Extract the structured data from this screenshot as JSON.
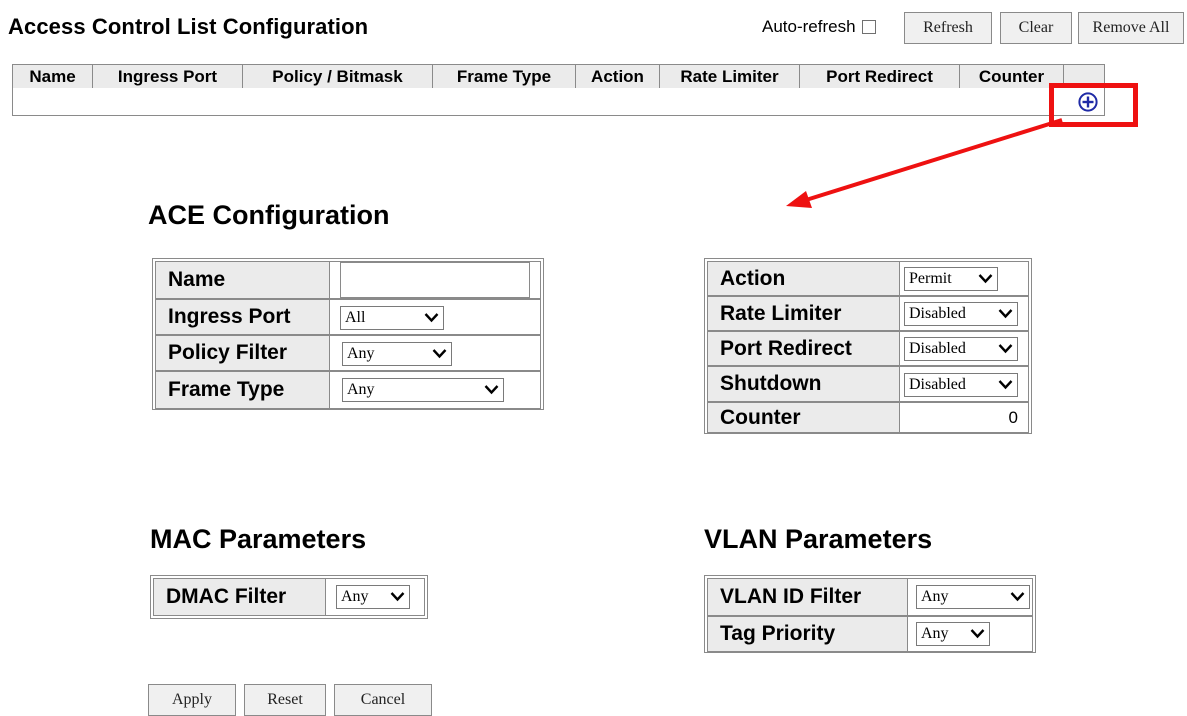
{
  "header": {
    "title": "Access Control List Configuration",
    "auto_refresh_label": "Auto-refresh",
    "refresh_label": "Refresh",
    "clear_label": "Clear",
    "remove_all_label": "Remove All"
  },
  "acl_table": {
    "columns": [
      "Name",
      "Ingress Port",
      "Policy / Bitmask",
      "Frame Type",
      "Action",
      "Rate Limiter",
      "Port Redirect",
      "Counter"
    ],
    "add_icon": "plus-circle-icon"
  },
  "ace_config": {
    "title": "ACE Configuration",
    "left": {
      "name_label": "Name",
      "name_value": "",
      "ingress_port_label": "Ingress Port",
      "ingress_port_value": "All",
      "policy_filter_label": "Policy Filter",
      "policy_filter_value": "Any",
      "frame_type_label": "Frame Type",
      "frame_type_value": "Any"
    },
    "right": {
      "action_label": "Action",
      "action_value": "Permit",
      "rate_limiter_label": "Rate Limiter",
      "rate_limiter_value": "Disabled",
      "port_redirect_label": "Port Redirect",
      "port_redirect_value": "Disabled",
      "shutdown_label": "Shutdown",
      "shutdown_value": "Disabled",
      "counter_label": "Counter",
      "counter_value": "0"
    }
  },
  "mac_params": {
    "title": "MAC Parameters",
    "dmac_filter_label": "DMAC Filter",
    "dmac_filter_value": "Any"
  },
  "vlan_params": {
    "title": "VLAN Parameters",
    "vlan_id_filter_label": "VLAN ID Filter",
    "vlan_id_filter_value": "Any",
    "tag_priority_label": "Tag Priority",
    "tag_priority_value": "Any"
  },
  "footer": {
    "apply_label": "Apply",
    "reset_label": "Reset",
    "cancel_label": "Cancel"
  },
  "colors": {
    "highlight": "#ee1111",
    "add_icon": "#1f2aa6",
    "header_bg": "#ebebeb"
  }
}
